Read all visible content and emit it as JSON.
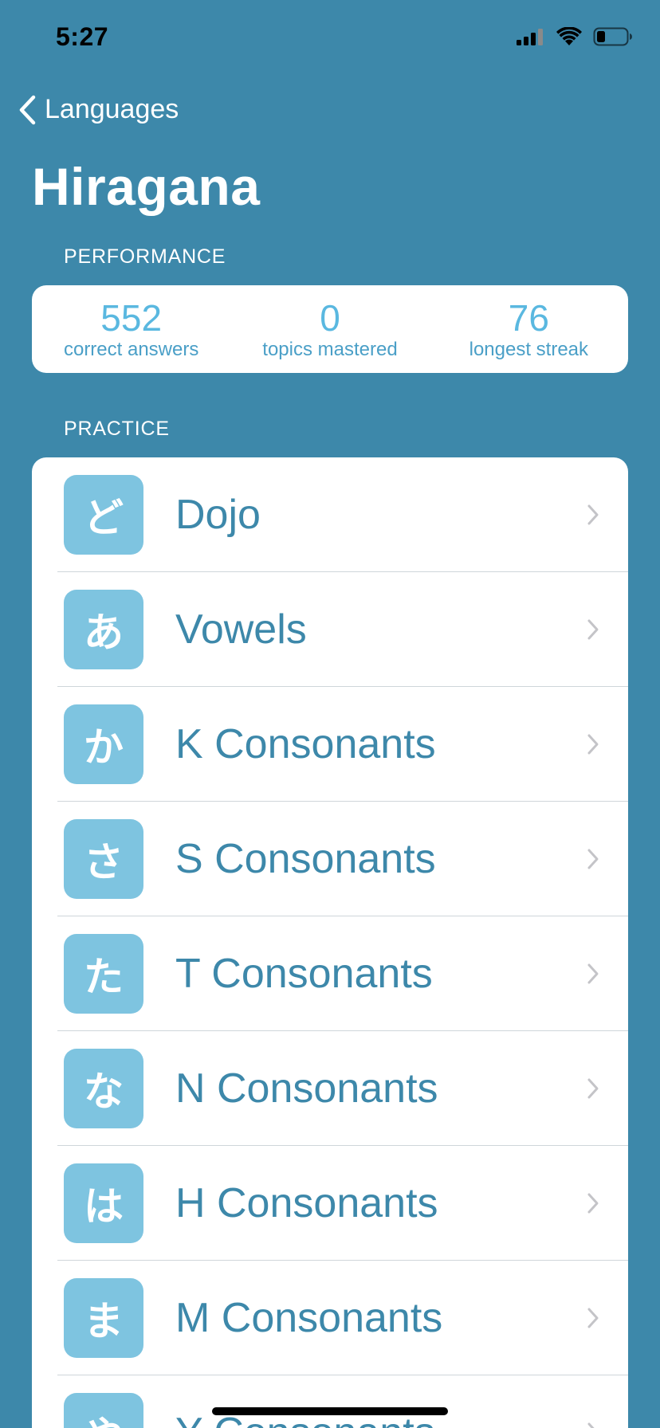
{
  "status_bar": {
    "time": "5:27",
    "icons": [
      "cellular-signal-icon",
      "wifi-icon",
      "battery-icon"
    ]
  },
  "nav": {
    "back_label": "Languages",
    "back_icon": "chevron-left-icon"
  },
  "title": "Hiragana",
  "performance": {
    "header": "PERFORMANCE",
    "stats": [
      {
        "value": "552",
        "label": "correct answers"
      },
      {
        "value": "0",
        "label": "topics mastered"
      },
      {
        "value": "76",
        "label": "longest streak"
      }
    ]
  },
  "practice": {
    "header": "PRACTICE",
    "items": [
      {
        "glyph": "ど",
        "label": "Dojo"
      },
      {
        "glyph": "あ",
        "label": "Vowels"
      },
      {
        "glyph": "か",
        "label": "K Consonants"
      },
      {
        "glyph": "さ",
        "label": "S Consonants"
      },
      {
        "glyph": "た",
        "label": "T Consonants"
      },
      {
        "glyph": "な",
        "label": "N Consonants"
      },
      {
        "glyph": "は",
        "label": "H Consonants"
      },
      {
        "glyph": "ま",
        "label": "M Consonants"
      },
      {
        "glyph": "や",
        "label": "Y Consonants"
      }
    ]
  },
  "colors": {
    "background": "#3d88aa",
    "accent_text": "#3d88aa",
    "stat_value": "#5ab8e0",
    "icon_tile": "#7ec4e0"
  }
}
